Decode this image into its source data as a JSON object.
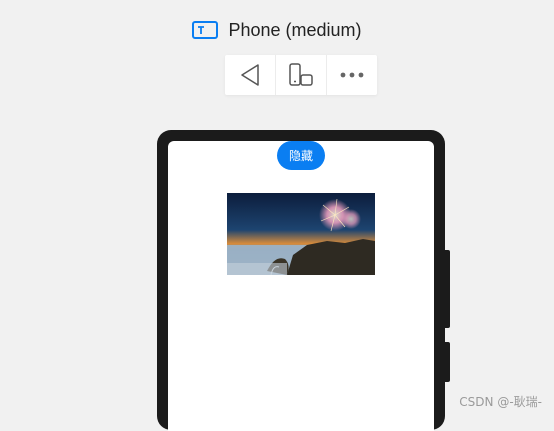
{
  "header": {
    "device_title": "Phone (medium)",
    "device_icon": "phone-frame-icon"
  },
  "toolbar": {
    "items": [
      {
        "name": "back",
        "icon": "triangle-back-icon"
      },
      {
        "name": "rotate",
        "icon": "device-rotate-icon"
      },
      {
        "name": "more",
        "icon": "more-dots-icon"
      }
    ]
  },
  "preview": {
    "hide_button_label": "隐藏",
    "image_subject": "fireworks-over-coastline"
  },
  "watermark": "CSDN @-耿瑞-",
  "colors": {
    "accent": "#0a7ef2",
    "background": "#f1f1f1",
    "device_frame": "#1b1b1b"
  }
}
